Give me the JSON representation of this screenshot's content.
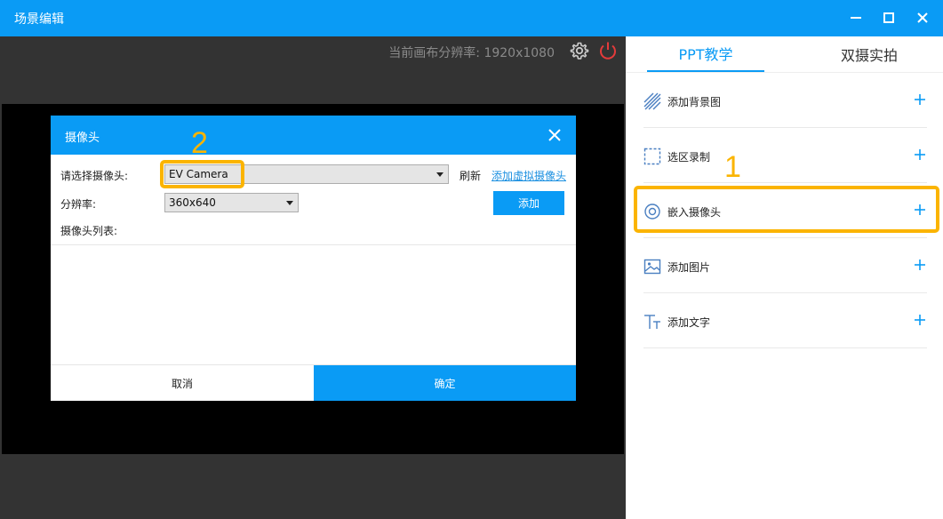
{
  "window": {
    "title": "场景编辑"
  },
  "canvas_bar": {
    "resolution_text": "当前画布分辨率:  1920x1080"
  },
  "dialog": {
    "title": "摄像头",
    "camera_label": "请选择摄像头:",
    "camera_value": "EV Camera",
    "refresh_label": "刷新",
    "virtual_link": "添加虚拟摄像头",
    "resolution_label": "分辨率:",
    "resolution_value": "360x640",
    "add_label": "添加",
    "list_label": "摄像头列表:",
    "cancel_label": "取消",
    "ok_label": "确定"
  },
  "right_panel": {
    "tabs": [
      {
        "label": "PPT教学",
        "active": true
      },
      {
        "label": "双摄实拍",
        "active": false
      }
    ],
    "items": [
      {
        "label": "添加背景图",
        "icon": "background-icon"
      },
      {
        "label": "选区录制",
        "icon": "region-select-icon"
      },
      {
        "label": "嵌入摄像头",
        "icon": "camera-icon"
      },
      {
        "label": "添加图片",
        "icon": "image-icon"
      },
      {
        "label": "添加文字",
        "icon": "text-icon"
      }
    ]
  },
  "annotations": {
    "n1": "1",
    "n2": "2"
  },
  "colors": {
    "accent": "#0a9bf5",
    "highlight": "#fbb400",
    "power": "#e43b3b"
  }
}
